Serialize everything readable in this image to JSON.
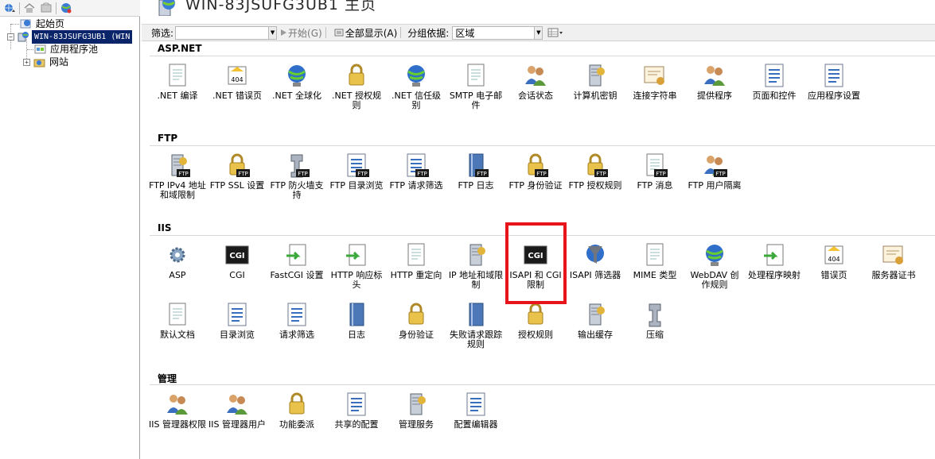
{
  "left_toolbar": {
    "icons": [
      "connect-icon",
      "home-icon",
      "save-icon",
      "globe-icon"
    ]
  },
  "tree": {
    "start_page": "起始页",
    "server": "WIN-83JSUFG3UB1 (WIN",
    "app_pools": "应用程序池",
    "sites": "网站",
    "expander_collapsed": "+",
    "expander_expanded": "−"
  },
  "header": {
    "title": "WIN-83JSUFG3UB1 主页"
  },
  "filter_bar": {
    "filter_label": "筛选:",
    "filter_value": "",
    "start_label": "开始(G)",
    "show_all_label": "全部显示(A)",
    "group_by_label": "分组依据:",
    "group_by_value": "区域"
  },
  "sections": [
    {
      "title": "ASP.NET",
      "items": [
        {
          "label": ".NET 编译",
          "icon": "dotnet-compile-icon"
        },
        {
          "label": ".NET 错误页",
          "icon": "dotnet-error-pages-icon"
        },
        {
          "label": ".NET 全球化",
          "icon": "dotnet-globalization-icon"
        },
        {
          "label": ".NET 授权规则",
          "icon": "dotnet-authorization-icon"
        },
        {
          "label": ".NET 信任级别",
          "icon": "dotnet-trust-levels-icon"
        },
        {
          "label": "SMTP 电子邮件",
          "icon": "smtp-email-icon"
        },
        {
          "label": "会话状态",
          "icon": "session-state-icon"
        },
        {
          "label": "计算机密钥",
          "icon": "machine-key-icon"
        },
        {
          "label": "连接字符串",
          "icon": "connection-strings-icon"
        },
        {
          "label": "提供程序",
          "icon": "providers-icon"
        },
        {
          "label": "页面和控件",
          "icon": "pages-controls-icon"
        },
        {
          "label": "应用程序设置",
          "icon": "app-settings-icon"
        }
      ]
    },
    {
      "title": "FTP",
      "items": [
        {
          "label": "FTP IPv4 地址和域限制",
          "icon": "ftp-ipv4-icon"
        },
        {
          "label": "FTP SSL 设置",
          "icon": "ftp-ssl-icon"
        },
        {
          "label": "FTP 防火墙支持",
          "icon": "ftp-firewall-icon"
        },
        {
          "label": "FTP 目录浏览",
          "icon": "ftp-directory-browsing-icon"
        },
        {
          "label": "FTP 请求筛选",
          "icon": "ftp-request-filtering-icon"
        },
        {
          "label": "FTP 日志",
          "icon": "ftp-logging-icon"
        },
        {
          "label": "FTP 身份验证",
          "icon": "ftp-authentication-icon"
        },
        {
          "label": "FTP 授权规则",
          "icon": "ftp-authorization-icon"
        },
        {
          "label": "FTP 消息",
          "icon": "ftp-messages-icon"
        },
        {
          "label": "FTP 用户隔离",
          "icon": "ftp-user-isolation-icon"
        }
      ]
    },
    {
      "title": "IIS",
      "items": [
        {
          "label": "ASP",
          "icon": "asp-icon"
        },
        {
          "label": "CGI",
          "icon": "cgi-icon"
        },
        {
          "label": "FastCGI 设置",
          "icon": "fastcgi-icon"
        },
        {
          "label": "HTTP 响应标头",
          "icon": "http-response-headers-icon"
        },
        {
          "label": "HTTP 重定向",
          "icon": "http-redirect-icon"
        },
        {
          "label": "IP 地址和域限制",
          "icon": "ip-domain-restrictions-icon"
        },
        {
          "label": "ISAPI 和 CGI 限制",
          "icon": "isapi-cgi-restrictions-icon"
        },
        {
          "label": "ISAPI 筛选器",
          "icon": "isapi-filters-icon"
        },
        {
          "label": "MIME 类型",
          "icon": "mime-types-icon"
        },
        {
          "label": "WebDAV 创作规则",
          "icon": "webdav-icon"
        },
        {
          "label": "处理程序映射",
          "icon": "handler-mappings-icon"
        },
        {
          "label": "错误页",
          "icon": "error-pages-icon"
        },
        {
          "label": "服务器证书",
          "icon": "server-certificates-icon"
        },
        {
          "label": "默认文档",
          "icon": "default-document-icon"
        },
        {
          "label": "目录浏览",
          "icon": "directory-browsing-icon"
        },
        {
          "label": "请求筛选",
          "icon": "request-filtering-icon"
        },
        {
          "label": "日志",
          "icon": "logging-icon"
        },
        {
          "label": "身份验证",
          "icon": "authentication-icon"
        },
        {
          "label": "失败请求跟踪规则",
          "icon": "failed-request-tracing-icon"
        },
        {
          "label": "授权规则",
          "icon": "authorization-rules-icon"
        },
        {
          "label": "输出缓存",
          "icon": "output-caching-icon"
        },
        {
          "label": "压缩",
          "icon": "compression-icon"
        }
      ]
    },
    {
      "title": "管理",
      "items": [
        {
          "label": "IIS 管理器权限",
          "icon": "iis-manager-permissions-icon"
        },
        {
          "label": "IIS 管理器用户",
          "icon": "iis-manager-users-icon"
        },
        {
          "label": "功能委派",
          "icon": "feature-delegation-icon"
        },
        {
          "label": "共享的配置",
          "icon": "shared-configuration-icon"
        },
        {
          "label": "管理服务",
          "icon": "management-service-icon"
        },
        {
          "label": "配置编辑器",
          "icon": "configuration-editor-icon"
        }
      ]
    }
  ],
  "colors": {
    "highlight": "#e8141b",
    "tree_selection": "#0a246a"
  }
}
